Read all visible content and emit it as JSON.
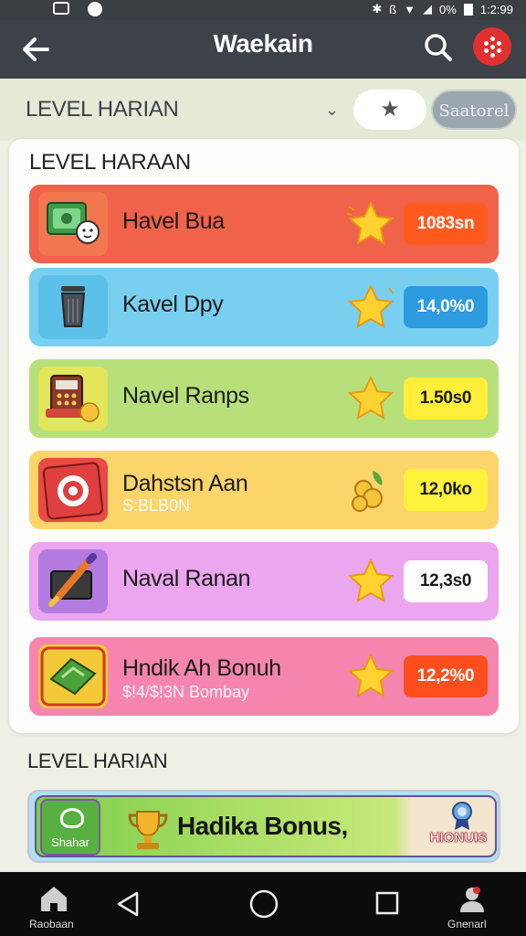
{
  "status_bar": {
    "time": "1:2:99",
    "battery_text": "0%"
  },
  "app_bar": {
    "title": "Waekain"
  },
  "header": {
    "title": "LEVEL HARIAN",
    "saved_label": "Saatorel"
  },
  "card": {
    "title": "LEVEL HARAAN",
    "rows": [
      {
        "name": "Havel Bua",
        "sub": "",
        "value": "1083sn",
        "bg": "#f0624a",
        "tile_bg": "#f2774f",
        "value_bg": "#ff5a1e",
        "value_color": "#ffffff"
      },
      {
        "name": "Kavel Dpy",
        "sub": "",
        "value": "14,0%0",
        "bg": "#79cff0",
        "tile_bg": "#5bc0ea",
        "value_bg": "#2c9be0",
        "value_color": "#ffffff"
      },
      {
        "name": "Navel Ranps",
        "sub": "",
        "value": "1.50s0",
        "bg": "#b7e07a",
        "tile_bg": "#e3e55b",
        "value_bg": "#ffef3a",
        "value_color": "#1a1a1a"
      },
      {
        "name": "Dahstsn Aan",
        "sub": "S:BLB0N",
        "value": "12,0ko",
        "bg": "#fbd46a",
        "tile_bg": "#e84a44",
        "value_bg": "#fff23a",
        "value_color": "#1a1a1a"
      },
      {
        "name": "Naval Ranan",
        "sub": "",
        "value": "12,3s0",
        "bg": "#eba6ef",
        "tile_bg": "#b37be0",
        "value_bg": "#ffffff",
        "value_color": "#1a1a1a"
      },
      {
        "name": "Hndik Ah Bonuh",
        "sub": "$!4/$!3N Bombay",
        "value": "12,2%0",
        "bg": "#f585ae",
        "tile_bg": "#f3c93a",
        "value_bg": "#ff4e1e",
        "value_color": "#ffffff"
      }
    ]
  },
  "section2": {
    "title": "LEVEL HARIAN"
  },
  "bonus": {
    "left_label": "Shahar",
    "title": "Hadika Bonus,",
    "tag": "HIONUIS"
  },
  "nav": {
    "home_label": "Raobaan",
    "profile_label": "Gnenarl"
  }
}
